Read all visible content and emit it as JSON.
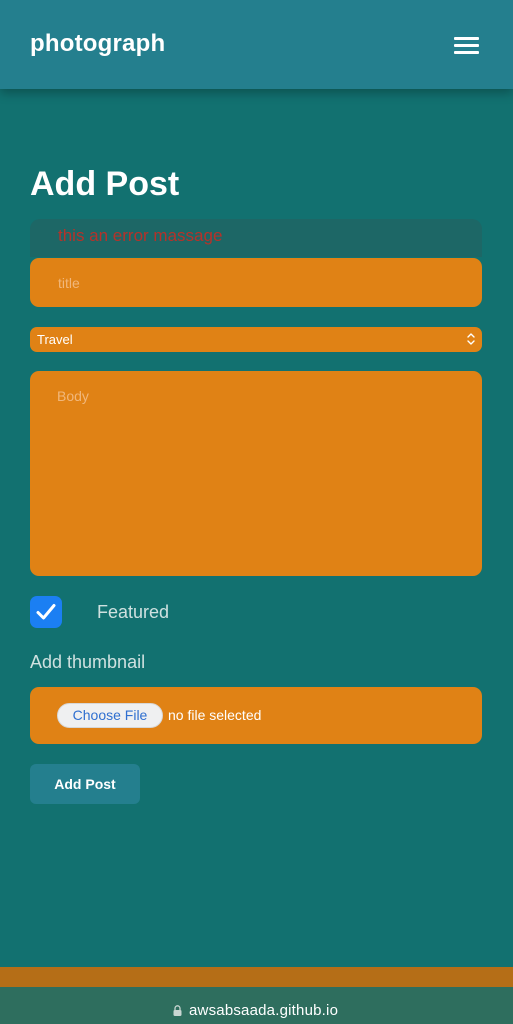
{
  "header": {
    "brand": "photograph",
    "menu_icon": "hamburger-menu-icon"
  },
  "form": {
    "heading": "Add Post",
    "error_message": "this an error massage",
    "title_placeholder": "title",
    "category": {
      "selected": "Travel",
      "icon": "select-updown-icon"
    },
    "body_placeholder": "Body",
    "featured": {
      "label": "Featured",
      "checked": true,
      "icon": "checkmark-icon"
    },
    "thumbnail": {
      "label": "Add thumbnail",
      "choose_button": "Choose File",
      "status": "no file selected"
    },
    "submit_label": "Add Post"
  },
  "browser": {
    "url": "awsabsaada.github.io",
    "lock_icon": "lock-icon"
  },
  "colors": {
    "background": "#127170",
    "header": "#247f8e",
    "field": "#e08215",
    "error_text": "#b5322a",
    "checkbox": "#1b7ff3",
    "footer_strip": "#b56e17",
    "url_bar": "#2e6e5e"
  }
}
